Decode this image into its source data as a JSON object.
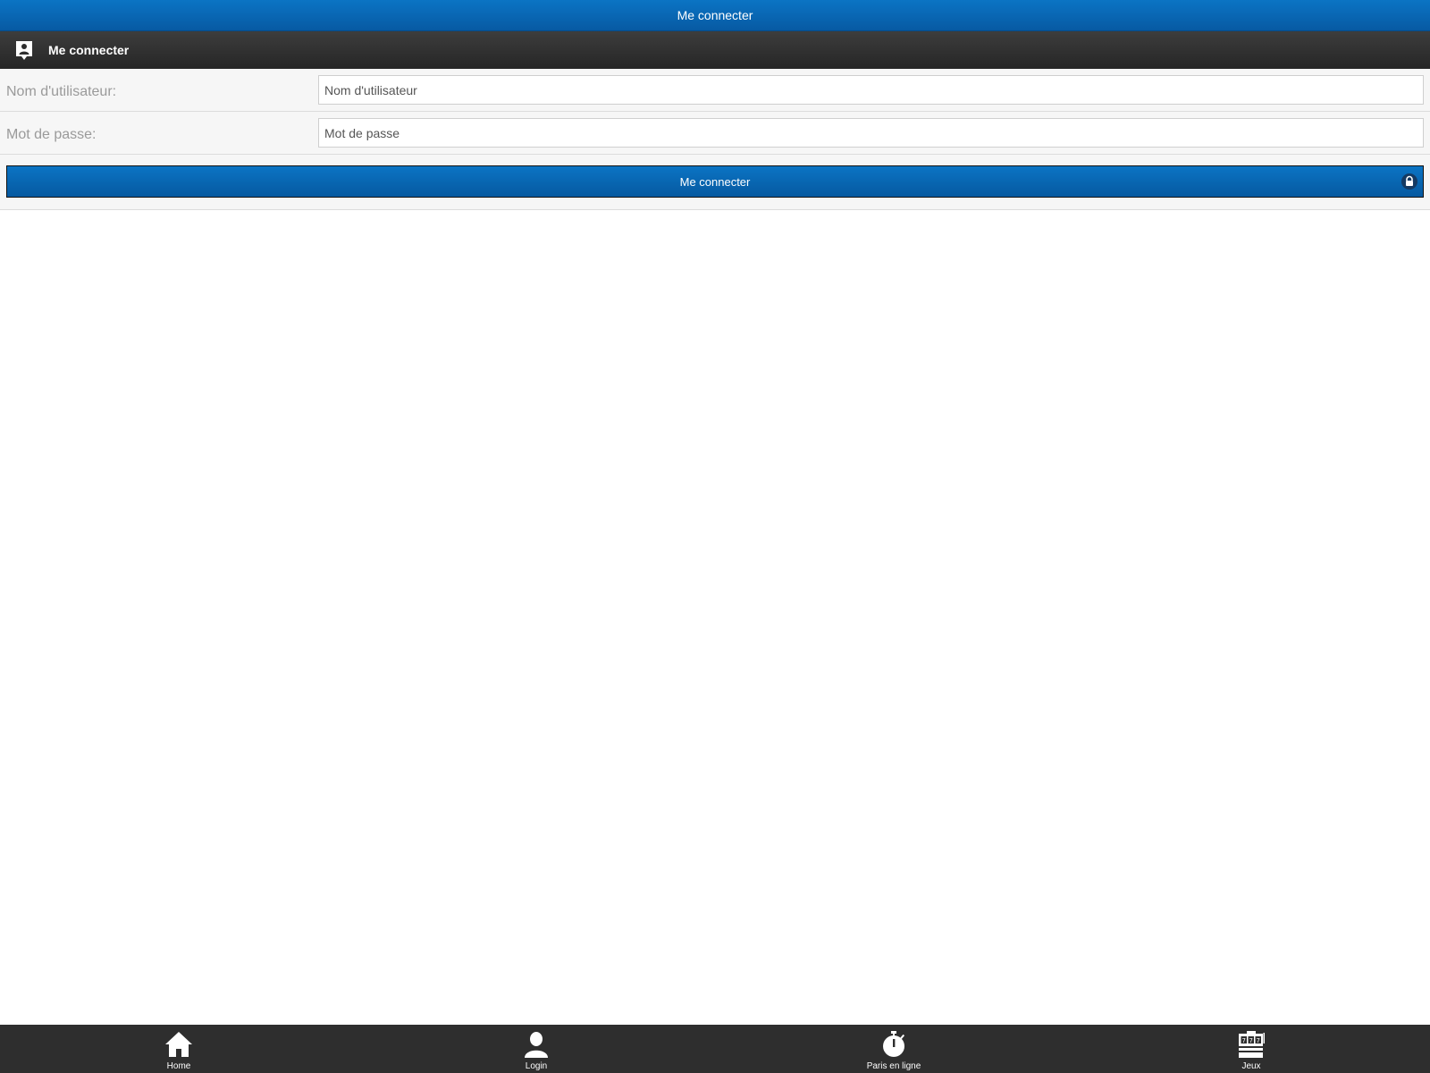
{
  "topbar": {
    "title": "Me connecter"
  },
  "section": {
    "title": "Me connecter",
    "icon": "user-card-icon"
  },
  "form": {
    "username": {
      "label": "Nom d'utilisateur:",
      "placeholder": "Nom d'utilisateur",
      "value": ""
    },
    "password": {
      "label": "Mot de passe:",
      "placeholder": "Mot de passe",
      "value": ""
    },
    "submit": {
      "label": "Me connecter",
      "icon": "lock-icon"
    }
  },
  "nav": {
    "items": [
      {
        "label": "Home",
        "icon": "home-icon"
      },
      {
        "label": "Login",
        "icon": "user-icon"
      },
      {
        "label": "Paris en ligne",
        "icon": "stopwatch-icon"
      },
      {
        "label": "Jeux",
        "icon": "slot-machine-icon"
      }
    ]
  },
  "colors": {
    "accent": "#0b74c4",
    "dark_bar": "#2e2e2e",
    "form_bg": "#f6f6f6"
  }
}
